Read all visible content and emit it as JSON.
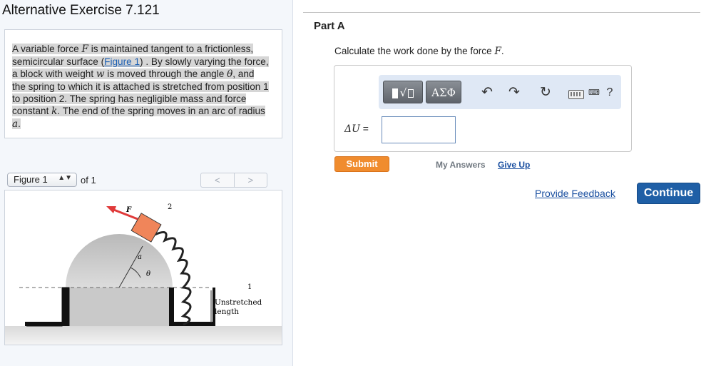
{
  "exercise": {
    "title": "Alternative Exercise 7.121"
  },
  "problem": {
    "t1": "A variable force ",
    "force_symbol": "F",
    "t2": " is maintained tangent to a frictionless, semicircular surface (",
    "figure_link": "Figure 1",
    "t3": ") . By slowly varying the force, a block with weight ",
    "weight_symbol": "w",
    "t4": " is moved through the angle ",
    "angle_symbol": "θ",
    "t5": ", and the spring to which it is attached is stretched from position 1 to position 2. The spring has negligible mass and force constant ",
    "k_symbol": "k",
    "t6": ". The end of the spring moves in an arc of radius ",
    "radius_symbol": "a",
    "t7": "."
  },
  "figure_nav": {
    "selected": "Figure 1",
    "of_label": "of 1",
    "prev": "<",
    "next": ">"
  },
  "figure": {
    "label_F": "F",
    "label_2": "2",
    "label_1": "1",
    "label_a": "a",
    "label_theta": "θ",
    "label_unstretched": "Unstretched",
    "label_length": "length",
    "block_color": "#f0855a",
    "force_color": "#e03a3a"
  },
  "part": {
    "title": "Part A",
    "question_prefix": "Calculate the work done by the force ",
    "question_symbol": "F",
    "question_suffix": "."
  },
  "toolbar": {
    "template_label": "√",
    "greek_label": "ΑΣΦ",
    "undo_icon": "↶",
    "redo_icon": "↷",
    "reset_icon": "↻",
    "help_label": "?"
  },
  "answer": {
    "variable_label": "ΔU",
    "equals": " =",
    "value": ""
  },
  "actions": {
    "submit": "Submit",
    "my_answers": "My Answers",
    "give_up": "Give Up",
    "feedback": "Provide Feedback",
    "continue": "Continue"
  },
  "colors": {
    "submit": "#f08c2e",
    "continue": "#1f5fa6",
    "link": "#1a4fa0",
    "toolbar_bg": "#dfe8f5"
  }
}
